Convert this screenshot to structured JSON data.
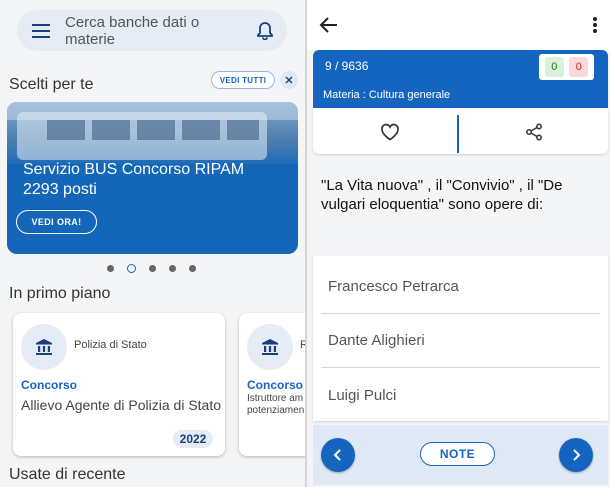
{
  "left": {
    "search": {
      "placeholder": "Cerca banche dati o materie",
      "menu_icon": "menu-icon",
      "bell_icon": "bell-icon"
    },
    "scelti": {
      "title": "Scelti per te",
      "vedi_tutti": "VEDI TUTTI",
      "close_icon": "close-icon",
      "banner": {
        "text": "Servizio BUS Concorso RIPAM 2293 posti",
        "button": "VEDI ORA!"
      },
      "carousel": {
        "count": 5,
        "active_index": 1
      }
    },
    "primo_piano": {
      "title": "In primo piano",
      "cards": [
        {
          "org": "Polizia di Stato",
          "kind": "Concorso",
          "title": "Allievo Agente di Polizia di Stato",
          "year": "2022"
        },
        {
          "org": "R",
          "kind": "Concorso",
          "title": "Istruttore am potenziamen",
          "year": ""
        }
      ]
    },
    "recenti": {
      "title": "Usate di recente"
    }
  },
  "right": {
    "question_header": {
      "counter": "9 / 9636",
      "subject": "Materia : Cultura generale",
      "correct": "0",
      "wrong": "0"
    },
    "question": "\"La Vita nuova\" , il \"Convivio\" , il \"De vulgari eloquentia\" sono opere di:",
    "answers": [
      "Francesco Petrarca",
      "Dante Alighieri",
      "Luigi Pulci"
    ],
    "bottom": {
      "note": "NOTE"
    }
  },
  "colors": {
    "primary": "#1565c0",
    "chip_bg": "#e5ecf6",
    "correct": "#1a7a1a",
    "wrong": "#c62828"
  }
}
